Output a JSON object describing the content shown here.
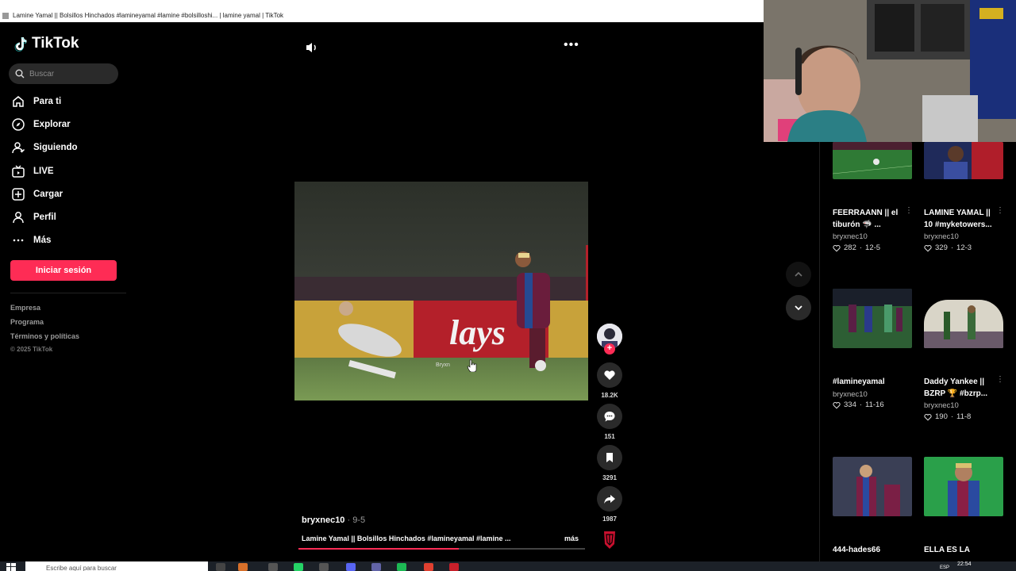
{
  "browser": {
    "tab_title": "Lamine Yamal || Bolsillos Hinchados #lamineyamal #lamine #bolsilloshi... | lamine yamal | TikTok"
  },
  "sidebar": {
    "logo": "TikTok",
    "search_placeholder": "Buscar",
    "nav": [
      {
        "label": "Para ti",
        "icon": "home-icon"
      },
      {
        "label": "Explorar",
        "icon": "compass-icon"
      },
      {
        "label": "Siguiendo",
        "icon": "following-icon"
      },
      {
        "label": "LIVE",
        "icon": "live-tv-icon"
      },
      {
        "label": "Cargar",
        "icon": "upload-icon"
      },
      {
        "label": "Perfil",
        "icon": "profile-icon"
      },
      {
        "label": "Más",
        "icon": "more-dots-icon"
      }
    ],
    "login_button": "Iniciar sesión",
    "footer": [
      "Empresa",
      "Programa",
      "Términos y políticas"
    ],
    "copyright": "© 2025 TikTok"
  },
  "video": {
    "author": "bryxnec10",
    "date": " · 9-5",
    "caption": "Lamine Yamal || Bolsillos Hinchados  #lamineyamal #lamine ...",
    "more": "más",
    "progress": 0.56,
    "likes": "18.2K",
    "comments": "151",
    "saves": "3291",
    "shares": "1987",
    "accent": "#fe2c55"
  },
  "related": [
    {
      "title": "FEERRAANN || el tiburón 🦈 ...",
      "author": "bryxnec10",
      "likes": "282",
      "date": "12-5"
    },
    {
      "title": "LAMINE YAMAL || 10 #myketowers...",
      "author": "bryxnec10",
      "likes": "329",
      "date": "12-3"
    },
    {
      "title": "#lamineyamal",
      "author": "bryxnec10",
      "likes": "334",
      "date": "11-16"
    },
    {
      "title": "Daddy Yankee || BZRP 🏆 #bzrp...",
      "author": "bryxnec10",
      "likes": "190",
      "date": "11-8"
    },
    {
      "title": "444-hades66",
      "author": "",
      "likes": "",
      "date": ""
    },
    {
      "title": "ELLA ES LA",
      "author": "",
      "likes": "",
      "date": ""
    }
  ],
  "taskbar": {
    "search_placeholder": "Escribe aquí para buscar",
    "time": "22:54",
    "lang": "ESP"
  }
}
